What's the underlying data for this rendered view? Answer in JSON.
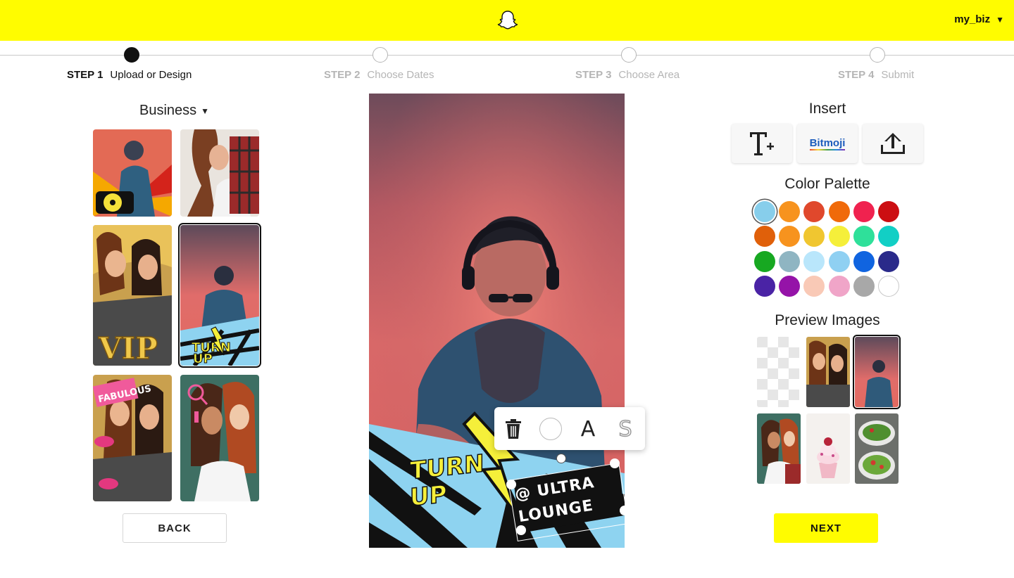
{
  "header": {
    "account_name": "my_biz",
    "brand_color": "#fffc00"
  },
  "steps": [
    {
      "number": "STEP 1",
      "label": "Upload or Design",
      "active": true
    },
    {
      "number": "STEP 2",
      "label": "Choose Dates",
      "active": false
    },
    {
      "number": "STEP 3",
      "label": "Choose Area",
      "active": false
    },
    {
      "number": "STEP 4",
      "label": "Submit",
      "active": false
    }
  ],
  "templates": {
    "category": "Business",
    "items": [
      {
        "name": "dj-turntable-template",
        "selected": false
      },
      {
        "name": "friends-plaid-template",
        "selected": false
      },
      {
        "name": "vip-template",
        "selected": false
      },
      {
        "name": "turn-up-template",
        "selected": true
      },
      {
        "name": "fabulous-template",
        "selected": false
      },
      {
        "name": "makeup-template",
        "selected": false
      }
    ]
  },
  "buttons": {
    "back": "BACK",
    "next": "NEXT"
  },
  "canvas": {
    "sticker_text": "TURN UP",
    "caption_text": "@ ULTRA LOUNGE"
  },
  "text_toolbar": {
    "font_letter": "A",
    "stroke_letter": "S",
    "icons": [
      "trash-icon",
      "color-circle-icon",
      "font-icon",
      "stroke-icon"
    ]
  },
  "insert": {
    "title": "Insert",
    "bitmoji_label": "Bitmoji",
    "icons": [
      "add-text-icon",
      "bitmoji-icon",
      "upload-icon"
    ]
  },
  "palette": {
    "title": "Color Palette",
    "selected_index": 0,
    "colors": [
      "#87ceeb",
      "#f7931e",
      "#e0482c",
      "#f06a0a",
      "#f0224f",
      "#cc0e12",
      "#e0600a",
      "#f7931e",
      "#f0c630",
      "#f5ef3a",
      "#2fe09a",
      "#12cfc5",
      "#17a821",
      "#8fb5c2",
      "#b9e6fb",
      "#8fd0f2",
      "#1064e0",
      "#2a2a8a",
      "#4a23a5",
      "#9513a8",
      "#f9c9b6",
      "#f0a5c8",
      "#a8a8a8",
      "#ffffff"
    ]
  },
  "preview_images": {
    "title": "Preview Images",
    "items": [
      {
        "name": "transparent-preview",
        "selected": false
      },
      {
        "name": "friends-preview",
        "selected": false
      },
      {
        "name": "dj-preview",
        "selected": true
      },
      {
        "name": "two-friends-preview",
        "selected": false
      },
      {
        "name": "cupcake-preview",
        "selected": false
      },
      {
        "name": "salad-preview",
        "selected": false
      }
    ]
  }
}
